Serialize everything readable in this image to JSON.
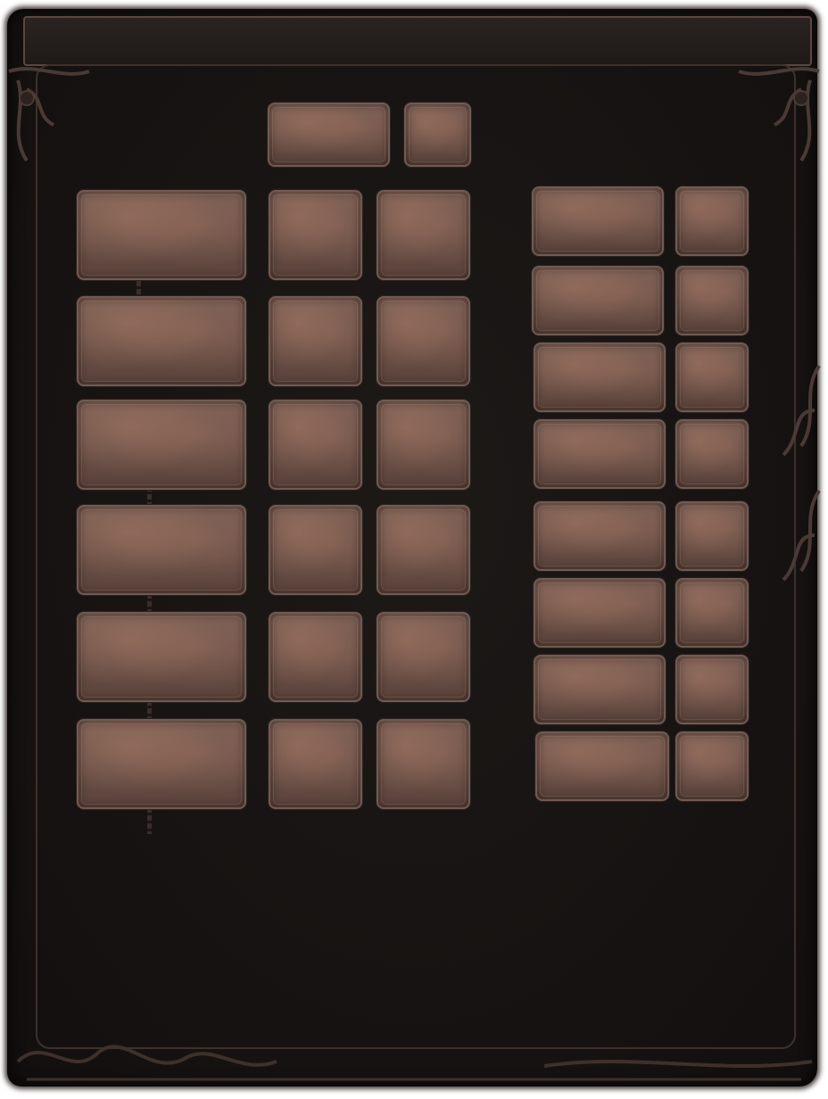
{
  "theme": {
    "frame_color": "#171312",
    "border_color": "#5b4740",
    "slot_color": "#6a5047",
    "slot_border": "#6f5b52"
  },
  "header": {
    "title": ""
  },
  "top_slots": [
    {
      "id": "top-wide"
    },
    {
      "id": "top-small"
    }
  ],
  "left_panel": {
    "rows": [
      {
        "slots": [
          "wide",
          "small",
          "small"
        ]
      },
      {
        "slots": [
          "wide",
          "small",
          "small"
        ]
      },
      {
        "slots": [
          "wide",
          "small",
          "small"
        ]
      },
      {
        "slots": [
          "wide",
          "small",
          "small"
        ]
      },
      {
        "slots": [
          "wide",
          "small",
          "small"
        ]
      },
      {
        "slots": [
          "wide",
          "small",
          "small"
        ]
      }
    ]
  },
  "right_panel": {
    "rows": [
      {
        "slots": [
          "wide",
          "small"
        ]
      },
      {
        "slots": [
          "wide",
          "small"
        ]
      },
      {
        "slots": [
          "wide",
          "small"
        ]
      },
      {
        "slots": [
          "wide",
          "small"
        ]
      },
      {
        "slots": [
          "wide",
          "small"
        ]
      },
      {
        "slots": [
          "wide",
          "small"
        ]
      },
      {
        "slots": [
          "wide",
          "small"
        ]
      },
      {
        "slots": [
          "wide",
          "small"
        ]
      }
    ]
  }
}
